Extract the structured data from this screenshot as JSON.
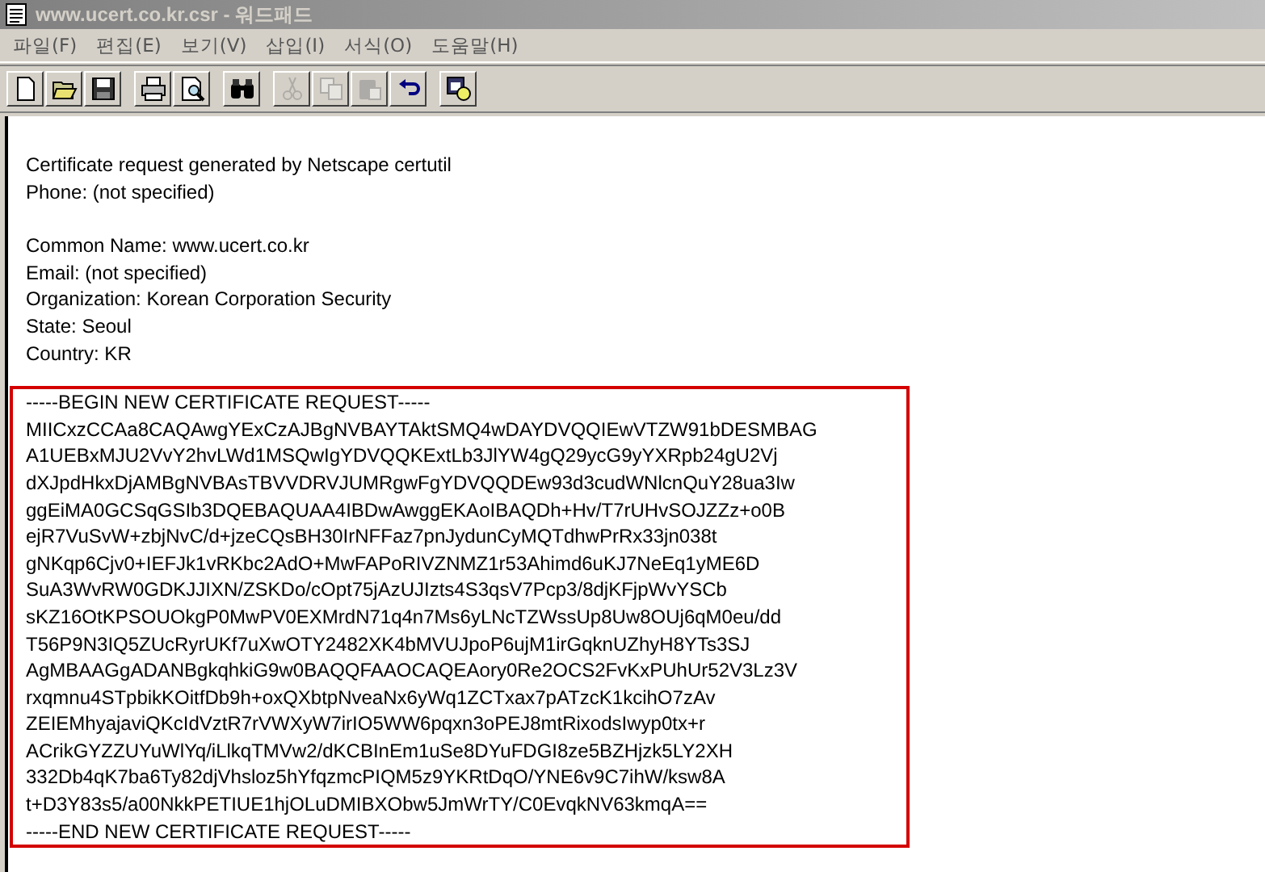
{
  "window": {
    "title": "www.ucert.co.kr.csr - 워드패드"
  },
  "menu": [
    {
      "label": "파일(F)"
    },
    {
      "label": "편집(E)"
    },
    {
      "label": "보기(V)"
    },
    {
      "label": "삽입(I)"
    },
    {
      "label": "서식(O)"
    },
    {
      "label": "도움말(H)"
    }
  ],
  "toolbar": [
    [
      {
        "kind": "new",
        "disabled": false
      },
      {
        "kind": "open",
        "disabled": false
      },
      {
        "kind": "save",
        "disabled": false
      }
    ],
    [
      {
        "kind": "print",
        "disabled": false
      },
      {
        "kind": "preview",
        "disabled": false
      }
    ],
    [
      {
        "kind": "find",
        "disabled": false
      }
    ],
    [
      {
        "kind": "cut",
        "disabled": true
      },
      {
        "kind": "copy",
        "disabled": true
      },
      {
        "kind": "paste",
        "disabled": true
      },
      {
        "kind": "undo",
        "disabled": false
      }
    ],
    [
      {
        "kind": "datetime",
        "disabled": false
      }
    ]
  ],
  "document": {
    "paragraphs": [
      [
        "Certificate request generated by Netscape certutil",
        "Phone: (not specified)"
      ],
      [
        "Common Name: www.ucert.co.kr",
        "Email: (not specified)",
        "Organization: Korean Corporation Security",
        "State: Seoul",
        "Country: KR"
      ]
    ],
    "highlighted_block": [
      "-----BEGIN NEW CERTIFICATE REQUEST-----",
      "MIICxzCCAa8CAQAwgYExCzAJBgNVBAYTAktSMQ4wDAYDVQQIEwVTZW91bDESMBAG",
      "A1UEBxMJU2VvY2hvLWd1MSQwIgYDVQQKExtLb3JlYW4gQ29ycG9yYXRpb24gU2Vj",
      "dXJpdHkxDjAMBgNVBAsTBVVDRVJUMRgwFgYDVQQDEw93d3cudWNlcnQuY28ua3Iw",
      "ggEiMA0GCSqGSIb3DQEBAQUAA4IBDwAwggEKAoIBAQDh+Hv/T7rUHvSOJZZz+o0B",
      "ejR7VuSvW+zbjNvC/d+jzeCQsBH30IrNFFaz7pnJydunCyMQTdhwPrRx33jn038t",
      "gNKqp6Cjv0+IEFJk1vRKbc2AdO+MwFAPoRIVZNMZ1r53Ahimd6uKJ7NeEq1yME6D",
      "SuA3WvRW0GDKJJIXN/ZSKDo/cOpt75jAzUJIzts4S3qsV7Pcp3/8djKFjpWvYSCb",
      "sKZ16OtKPSOUOkgP0MwPV0EXMrdN71q4n7Ms6yLNcTZWssUp8Uw8OUj6qM0eu/dd",
      "T56P9N3IQ5ZUcRyrUKf7uXwOTY2482XK4bMVUJpoP6ujM1irGqknUZhyH8YTs3SJ",
      "AgMBAAGgADANBgkqhkiG9w0BAQQFAAOCAQEAory0Re2OCS2FvKxPUhUr52V3Lz3V",
      "rxqmnu4STpbikKOitfDb9h+oxQXbtpNveaNx6yWq1ZCTxax7pATzcK1kcihO7zAv",
      "ZEIEMhyajaviQKcIdVztR7rVWXyW7irIO5WW6pqxn3oPEJ8mtRixodsIwyp0tx+r",
      "ACrikGYZZUYuWlYq/iLlkqTMVw2/dKCBInEm1uSe8DYuFDGI8ze5BZHjzk5LY2XH",
      "332Db4qK7ba6Ty82djVhsloz5hYfqzmcPIQM5z9YKRtDqO/YNE6v9C7ihW/ksw8A",
      "t+D3Y83s5/a00NkkPETIUE1hjOLuDMIBXObw5JmWrTY/C0EvqkNV63kmqA==",
      "-----END NEW CERTIFICATE REQUEST-----"
    ]
  }
}
